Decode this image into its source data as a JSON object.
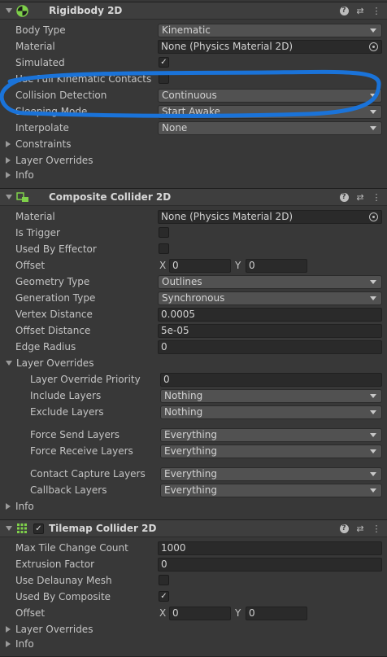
{
  "rigidbody": {
    "title": "Rigidbody 2D",
    "icon": "rigidbody-2d-icon",
    "body_type_label": "Body Type",
    "body_type_value": "Kinematic",
    "material_label": "Material",
    "material_value": "None (Physics Material 2D)",
    "simulated_label": "Simulated",
    "simulated_checked": true,
    "use_full_kinematic_label": "Use Full Kinematic Contacts",
    "collision_detection_label": "Collision Detection",
    "collision_detection_value": "Continuous",
    "sleeping_mode_label": "Sleeping Mode",
    "sleeping_mode_value": "Start Awake",
    "interpolate_label": "Interpolate",
    "interpolate_value": "None",
    "constraints_label": "Constraints",
    "layer_overrides_label": "Layer Overrides",
    "info_label": "Info"
  },
  "annotation_color": "#1a73d9",
  "composite": {
    "title": "Composite Collider 2D",
    "icon": "composite-collider-icon",
    "material_label": "Material",
    "material_value": "None (Physics Material 2D)",
    "is_trigger_label": "Is Trigger",
    "used_by_effector_label": "Used By Effector",
    "offset_label": "Offset",
    "offset_x": "0",
    "offset_y": "0",
    "x_label": "X",
    "y_label": "Y",
    "geometry_type_label": "Geometry Type",
    "geometry_type_value": "Outlines",
    "generation_type_label": "Generation Type",
    "generation_type_value": "Synchronous",
    "vertex_distance_label": "Vertex Distance",
    "vertex_distance_value": "0.0005",
    "offset_distance_label": "Offset Distance",
    "offset_distance_value": "5e-05",
    "edge_radius_label": "Edge Radius",
    "edge_radius_value": "0",
    "layer_overrides_label": "Layer Overrides",
    "layer_override_priority_label": "Layer Override Priority",
    "layer_override_priority_value": "0",
    "include_layers_label": "Include Layers",
    "include_layers_value": "Nothing",
    "exclude_layers_label": "Exclude Layers",
    "exclude_layers_value": "Nothing",
    "force_send_layers_label": "Force Send Layers",
    "force_send_layers_value": "Everything",
    "force_receive_layers_label": "Force Receive Layers",
    "force_receive_layers_value": "Everything",
    "contact_capture_layers_label": "Contact Capture Layers",
    "contact_capture_layers_value": "Everything",
    "callback_layers_label": "Callback Layers",
    "callback_layers_value": "Everything",
    "info_label": "Info"
  },
  "tilemap": {
    "title": "Tilemap Collider 2D",
    "icon": "tilemap-collider-icon",
    "enabled": true,
    "max_tile_change_count_label": "Max Tile Change Count",
    "max_tile_change_count_value": "1000",
    "extrusion_factor_label": "Extrusion Factor",
    "extrusion_factor_value": "0",
    "use_delaunay_mesh_label": "Use Delaunay Mesh",
    "used_by_composite_label": "Used By Composite",
    "used_by_composite_checked": true,
    "offset_label": "Offset",
    "offset_x": "0",
    "offset_y": "0",
    "x_label": "X",
    "y_label": "Y",
    "layer_overrides_label": "Layer Overrides",
    "info_label": "Info"
  },
  "header_icons": {
    "help": "?",
    "presets": "⇄",
    "menu": "⋮"
  }
}
